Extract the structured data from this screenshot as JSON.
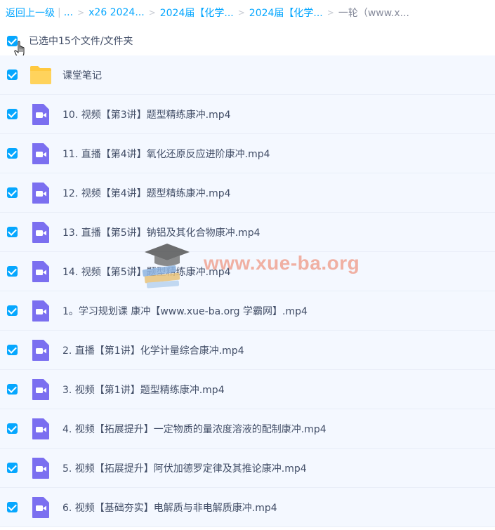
{
  "breadcrumb": {
    "back": "返回上一级",
    "pipe": "|",
    "ellipsis": "...",
    "items": [
      "x26 2024...",
      "2024届【化学...",
      "2024届【化学..."
    ],
    "current": "一轮（www.x..."
  },
  "selection": {
    "text": "已选中15个文件/文件夹"
  },
  "files": [
    {
      "name": "课堂笔记",
      "type": "folder-icon"
    },
    {
      "name": "10. 视频【第3讲】题型精练康冲.mp4",
      "type": "video-icon"
    },
    {
      "name": "11. 直播【第4讲】氧化还原反应进阶康冲.mp4",
      "type": "video-icon"
    },
    {
      "name": "12. 视频【第4讲】题型精练康冲.mp4",
      "type": "video-icon"
    },
    {
      "name": "13. 直播【第5讲】钠铝及其化合物康冲.mp4",
      "type": "video-icon"
    },
    {
      "name": "14. 视频【第5讲】题型精练康冲.mp4",
      "type": "video-icon"
    },
    {
      "name": "1。学习规划课 康冲【www.xue-ba.org 学霸网】.mp4",
      "type": "video-icon"
    },
    {
      "name": "2. 直播【第1讲】化学计量综合康冲.mp4",
      "type": "video-icon"
    },
    {
      "name": "3. 视频【第1讲】题型精练康冲.mp4",
      "type": "video-icon"
    },
    {
      "name": "4. 视频【拓展提升】一定物质的量浓度溶液的配制康冲.mp4",
      "type": "video-icon"
    },
    {
      "name": "5. 视频【拓展提升】阿伏加德罗定律及其推论康冲.mp4",
      "type": "video-icon"
    },
    {
      "name": "6. 视频【基础夯实】电解质与非电解质康冲.mp4",
      "type": "video-icon"
    }
  ],
  "watermark": {
    "text": "www.xue-ba.org"
  },
  "colors": {
    "accent": "#06a7ff",
    "video": "#7b6ff0",
    "folder": "#ffc940",
    "rowBg": "#f4f8ff"
  }
}
